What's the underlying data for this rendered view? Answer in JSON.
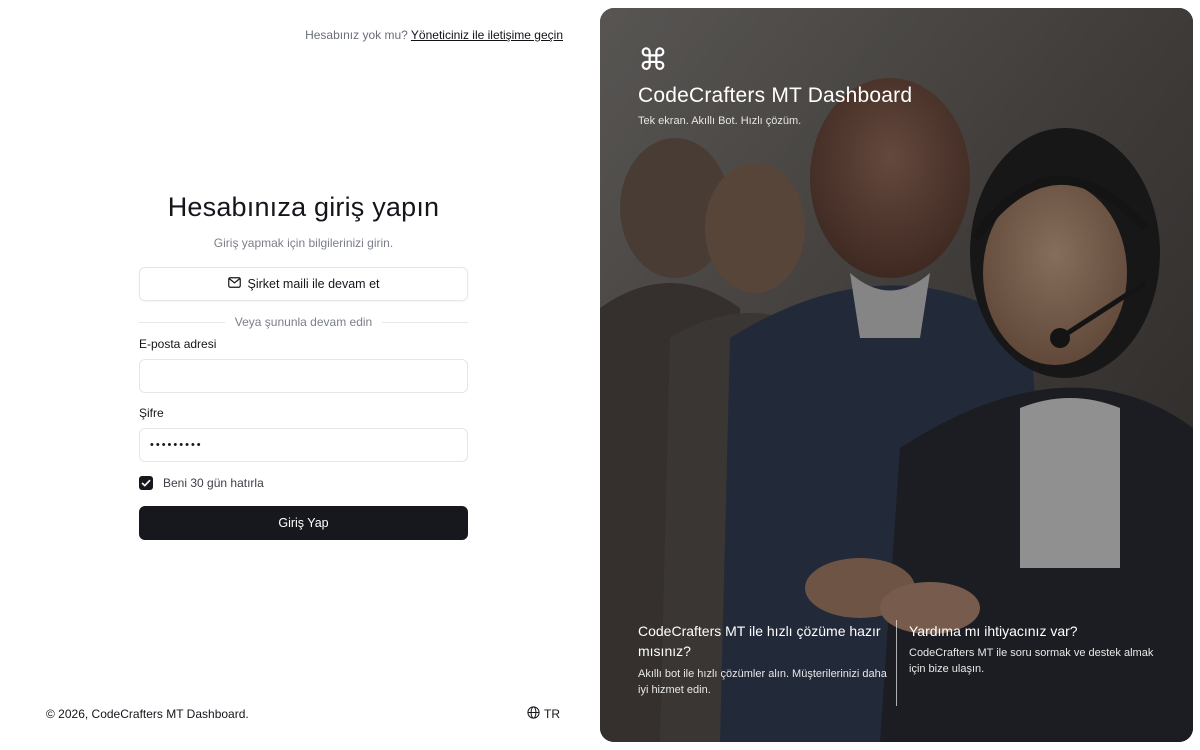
{
  "header": {
    "no_account_text": "Hesabınız yok mu?",
    "contact_admin_link": "Yöneticiniz ile iletişime geçin"
  },
  "login": {
    "title": "Hesabınıza giriş yapın",
    "subtitle": "Giriş yapmak için bilgilerinizi girin.",
    "sso_button_label": "Şirket maili ile devam et",
    "sso_icon": "mail-icon",
    "divider_text": "Veya şununla devam edin",
    "email_label": "E-posta adresi",
    "email_value": "",
    "email_placeholder": "",
    "password_label": "Şifre",
    "password_value": "•••••••••",
    "remember_label": "Beni 30 gün hatırla",
    "remember_checked": true,
    "submit_label": "Giriş Yap"
  },
  "footer": {
    "copyright": "© 2026, CodeCrafters MT Dashboard.",
    "language": "TR",
    "language_icon": "globe-icon"
  },
  "hero": {
    "icon": "command-icon",
    "icon_glyph": "⌘",
    "brand_name": "CodeCrafters MT Dashboard",
    "tagline": "Tek ekran. Akıllı Bot. Hızlı çözüm.",
    "cta_title": "CodeCrafters MT ile hızlı çözüme hazır mısınız?",
    "cta_description": "Akıllı bot ile hızlı çözümler alın. Müşterilerinizi daha iyi hizmet edin.",
    "help_title": "Yardıma mı ihtiyacınız var?",
    "help_description": "CodeCrafters MT ile soru sormak ve destek almak için bize ulaşın."
  },
  "colors": {
    "primary": "#16181d",
    "border": "#e4e6ea",
    "muted_text": "#7b7f88",
    "hero_overlay": "#141416"
  }
}
